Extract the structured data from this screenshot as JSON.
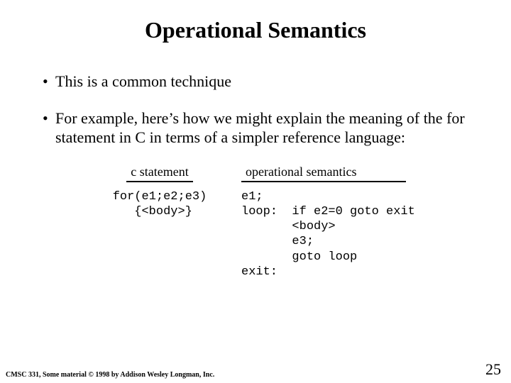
{
  "title": "Operational Semantics",
  "bullets": [
    "This is a common technique",
    "For example, here’s how we might explain the meaning of the for statement in C in terms of a simpler reference language:"
  ],
  "columns": {
    "left_header": "c statement",
    "right_header": "operational semantics",
    "left_code": "for(e1;e2;e3)\n {<body>}",
    "right_code": "e1;\nloop:  if e2=0 goto exit\n       <body>\n       e3;\n       goto loop\nexit:"
  },
  "footer": "CMSC 331, Some material © 1998 by Addison Wesley Longman, Inc.",
  "page_number": "25"
}
